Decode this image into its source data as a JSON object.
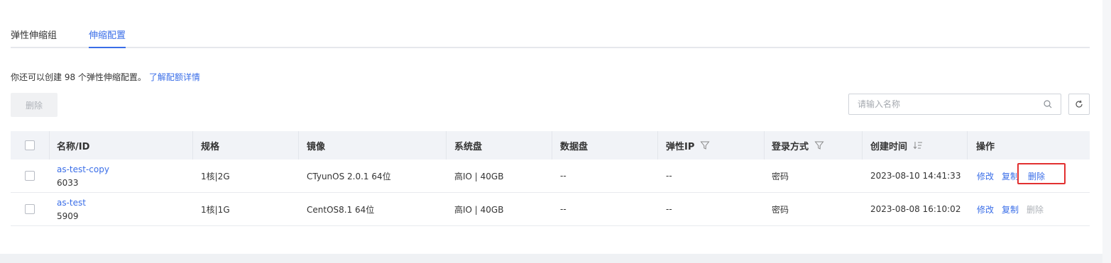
{
  "tabs": [
    {
      "label": "弹性伸缩组"
    },
    {
      "label": "伸缩配置"
    }
  ],
  "quota": {
    "text": "你还可以创建 98 个弹性伸缩配置。",
    "link": "了解配额详情"
  },
  "toolbar": {
    "delete_label": "删除",
    "search_placeholder": "请输入名称"
  },
  "table": {
    "headers": {
      "name": "名称/ID",
      "spec": "规格",
      "image": "镜像",
      "system_disk": "系统盘",
      "data_disk": "数据盘",
      "eip": "弹性IP",
      "login": "登录方式",
      "created": "创建时间",
      "actions": "操作"
    },
    "rows": [
      {
        "name": "as-test-copy",
        "id": "6033",
        "spec": "1核|2G",
        "image": "CTyunOS 2.0.1 64位",
        "system_disk": "高IO | 40GB",
        "data_disk": "--",
        "eip": "--",
        "login": "密码",
        "created": "2023-08-10 14:41:33",
        "edit": "修改",
        "copy": "复制",
        "delete": "删除"
      },
      {
        "name": "as-test",
        "id": "5909",
        "spec": "1核|1G",
        "image": "CentOS8.1 64位",
        "system_disk": "高IO | 40GB",
        "data_disk": "--",
        "eip": "--",
        "login": "密码",
        "created": "2023-08-08 16:10:02",
        "edit": "修改",
        "copy": "复制",
        "delete": "删除"
      }
    ]
  },
  "colors": {
    "accent": "#3a6ee8",
    "highlight": "#e23030",
    "disabled": "#aeb2b8"
  }
}
